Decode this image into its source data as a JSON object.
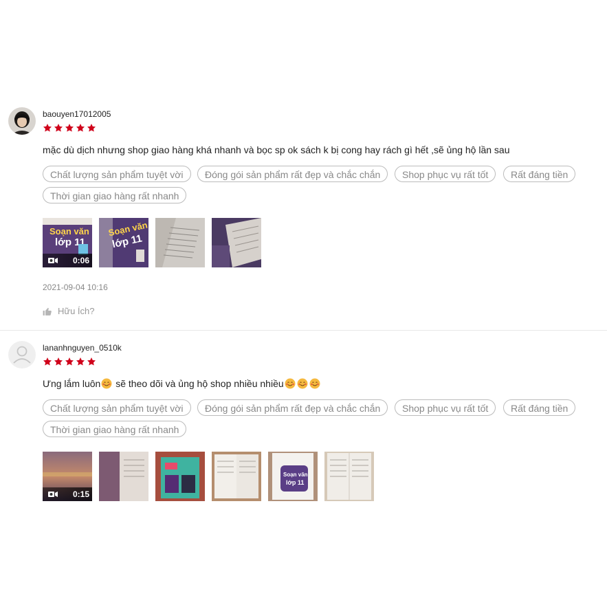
{
  "reviews": [
    {
      "username": "baouyen17012005",
      "rating": 5,
      "comment": "mặc dù dịch nhưng shop giao hàng khá nhanh và bọc sp ok sách k bị cong hay rách gì hết ,sẽ ủng hộ lần sau",
      "tags": [
        "Chất lượng sản phẩm tuyệt vời",
        "Đóng gói sản phẩm rất đẹp và chắc chắn",
        "Shop phục vụ rất tốt",
        "Rất đáng tiền",
        "Thời gian giao hàng rất nhanh"
      ],
      "video_duration": "0:06",
      "media_count": 4,
      "datetime": "2021-09-04 10:16",
      "helpful_label": "Hữu Ích?"
    },
    {
      "username": "lananhnguyen_0510k",
      "rating": 5,
      "comment_part1": "Ưng lắm luôn",
      "comment_part2": " sẽ theo dõi và ủng hộ shop nhiều nhiều",
      "tags": [
        "Chất lượng sản phẩm tuyệt vời",
        "Đóng gói sản phẩm rất đẹp và chắc chắn",
        "Shop phục vụ rất tốt",
        "Rất đáng tiền",
        "Thời gian giao hàng rất nhanh"
      ],
      "video_duration": "0:15",
      "media_count": 6
    }
  ],
  "colors": {
    "star": "#d0011b",
    "tag_border": "#bbbbbb",
    "tag_text": "#888888"
  },
  "icons": [
    "avatar-photo",
    "default-avatar-icon",
    "star-icon",
    "video-camera-icon",
    "thumbs-up-icon",
    "smiling-face-with-hearts-emoji"
  ]
}
